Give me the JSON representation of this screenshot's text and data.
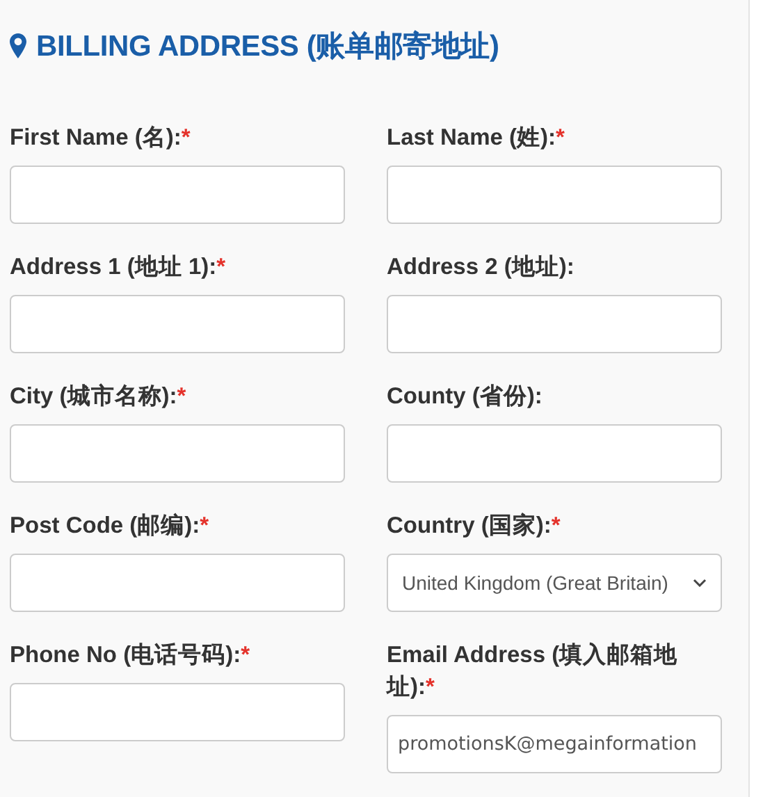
{
  "heading": {
    "title": "BILLING ADDRESS (账单邮寄地址)"
  },
  "fields": [
    {
      "kind": "text",
      "label": "First Name (名):",
      "required_mark": "*"
    },
    {
      "kind": "text",
      "label": "Last Name (姓):",
      "required_mark": "*"
    },
    {
      "kind": "text",
      "label": "Address 1 (地址 1):",
      "required_mark": "*"
    },
    {
      "kind": "text",
      "label": "Address 2 (地址):"
    },
    {
      "kind": "text",
      "label": "City (城市名称):",
      "required_mark": "*"
    },
    {
      "kind": "text",
      "label": "County (省份):"
    },
    {
      "kind": "text",
      "label": "Post Code (邮编):",
      "required_mark": "*"
    },
    {
      "kind": "select",
      "label": "Country (国家):",
      "required_mark": "*",
      "value": "United Kingdom (Great Britain)"
    },
    {
      "kind": "text",
      "label": "Phone No (电话号码):",
      "required_mark": "*"
    },
    {
      "kind": "text",
      "label": "Email Address (填入邮箱地址):",
      "required_mark": "*",
      "value": "promotionsK@megainformation"
    }
  ]
}
